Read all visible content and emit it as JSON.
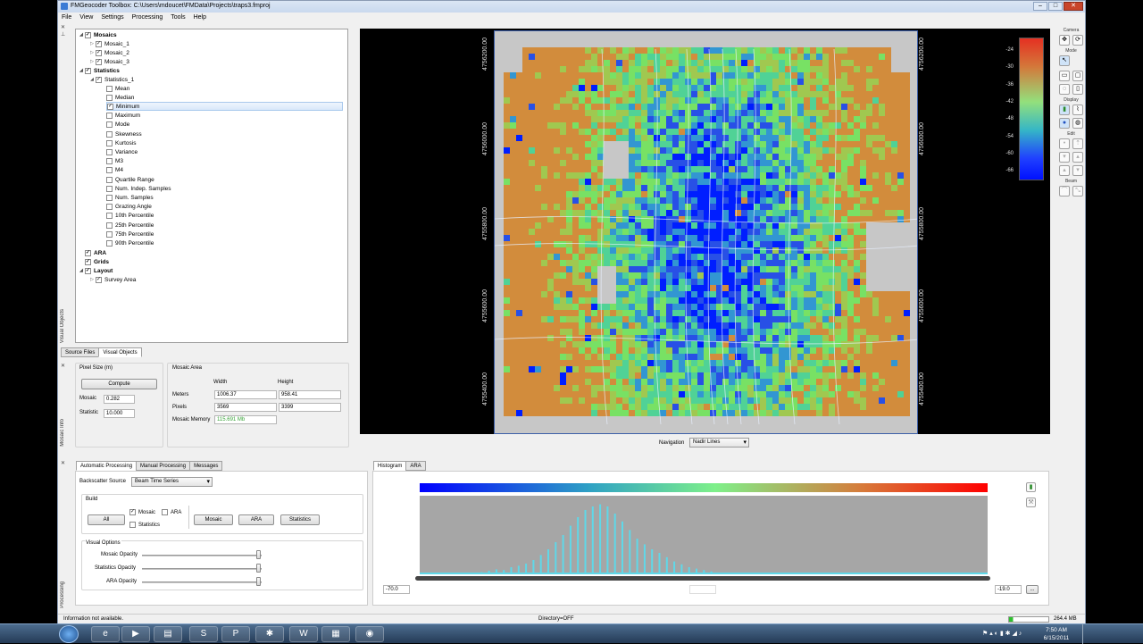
{
  "window": {
    "title": "FMGeocoder Toolbox: C:\\Users\\mdoucet\\FMData\\Projects\\traps3.fmproj"
  },
  "menu": [
    "File",
    "View",
    "Settings",
    "Processing",
    "Tools",
    "Help"
  ],
  "tree": {
    "mosaics_label": "Mosaics",
    "mosaics": [
      "Mosaic_1",
      "Mosaic_2",
      "Mosaic_3"
    ],
    "statistics_label": "Statistics",
    "statistics_1": "Statistics_1",
    "stat_items": [
      {
        "label": "Mean",
        "checked": false
      },
      {
        "label": "Median",
        "checked": false
      },
      {
        "label": "Minimum",
        "checked": true,
        "selected": true
      },
      {
        "label": "Maximum",
        "checked": false,
        "hover": true
      },
      {
        "label": "Mode",
        "checked": false
      },
      {
        "label": "Skewness",
        "checked": false
      },
      {
        "label": "Kurtosis",
        "checked": false
      },
      {
        "label": "Variance",
        "checked": false
      },
      {
        "label": "M3",
        "checked": false
      },
      {
        "label": "M4",
        "checked": false
      },
      {
        "label": "Quartile Range",
        "checked": false
      },
      {
        "label": "Num. Indep. Samples",
        "checked": false
      },
      {
        "label": "Num. Samples",
        "checked": false
      },
      {
        "label": "Grazing Angle",
        "checked": false
      },
      {
        "label": "10th Percentile",
        "checked": false
      },
      {
        "label": "25th Percentile",
        "checked": false
      },
      {
        "label": "75th Percentile",
        "checked": false
      },
      {
        "label": "90th Percentile",
        "checked": false
      }
    ],
    "ara_label": "ARA",
    "grids_label": "Grids",
    "layout_label": "Layout",
    "survey_area": "Survey Area"
  },
  "side_tabs": {
    "visual_objects": "Visual Objects",
    "mosaic_info": "Mosaic Info",
    "processing": "Processing"
  },
  "tree_tabs": [
    "Source Files",
    "Visual Objects"
  ],
  "mosaic_info": {
    "pixel_size_label": "Pixel Size (m)",
    "compute": "Compute",
    "mosaic_label": "Mosaic",
    "mosaic_value": "0.282",
    "statistic_label": "Statistic",
    "statistic_value": "10.000",
    "area_label": "Mosaic Area",
    "width_label": "Width",
    "height_label": "Height",
    "meters_label": "Meters",
    "meters_w": "1006.37",
    "meters_h": "958.41",
    "pixels_label": "Pixels",
    "pixels_w": "3569",
    "pixels_h": "3399",
    "memory_label": "Mosaic Memory",
    "memory_value": "115.691 Mb"
  },
  "processing": {
    "tabs": [
      "Automatic Processing",
      "Manual Processing",
      "Messages"
    ],
    "backscatter_label": "Backscatter Source",
    "backscatter_value": "Beam Time Series",
    "build_label": "Build",
    "all": "All",
    "mosaic_cb": "Mosaic",
    "ara_cb": "ARA",
    "statistics_cb": "Statistics",
    "mosaic_btn": "Mosaic",
    "ara_btn": "ARA",
    "statistics_btn": "Statistics",
    "visual_options": "Visual Options",
    "mosaic_opacity": "Mosaic Opacity",
    "statistics_opacity": "Statistics Opacity",
    "ara_opacity": "ARA Opacity"
  },
  "map": {
    "left_coords": [
      "4756200.00",
      "4756000.00",
      "4755800.00",
      "4755600.00",
      "4755400.00"
    ],
    "right_coords": [
      "4756200.00",
      "4756000.00",
      "4755800.00",
      "4755600.00",
      "4755400.00"
    ],
    "colorbar_ticks": [
      "-24",
      "-30",
      "-36",
      "-42",
      "-48",
      "-54",
      "-60",
      "-66"
    ],
    "navigation_label": "Navigation",
    "navigation_value": "Nadir Lines"
  },
  "toolbar": {
    "camera": "Camera",
    "mode": "Mode",
    "display": "Display",
    "edit": "Edit",
    "beam": "Beam"
  },
  "histogram": {
    "tabs": [
      "Histogram",
      "ARA"
    ],
    "min": "-70.0",
    "max": "-19.0",
    "more": "...",
    "bars": [
      0.02,
      0.03,
      0.05,
      0.07,
      0.06,
      0.1,
      0.12,
      0.15,
      0.2,
      0.27,
      0.35,
      0.45,
      0.55,
      0.68,
      0.8,
      0.9,
      0.95,
      0.98,
      0.95,
      0.85,
      0.74,
      0.62,
      0.5,
      0.42,
      0.35,
      0.3,
      0.24,
      0.18,
      0.14,
      0.1,
      0.08,
      0.06,
      0.04,
      0.02,
      0.01
    ]
  },
  "status": {
    "info": "Information not available.",
    "directory": "Directory=OFF",
    "memory": "264.4 MB"
  },
  "taskbar": {
    "time": "7:50 AM",
    "date": "6/15/2011"
  }
}
